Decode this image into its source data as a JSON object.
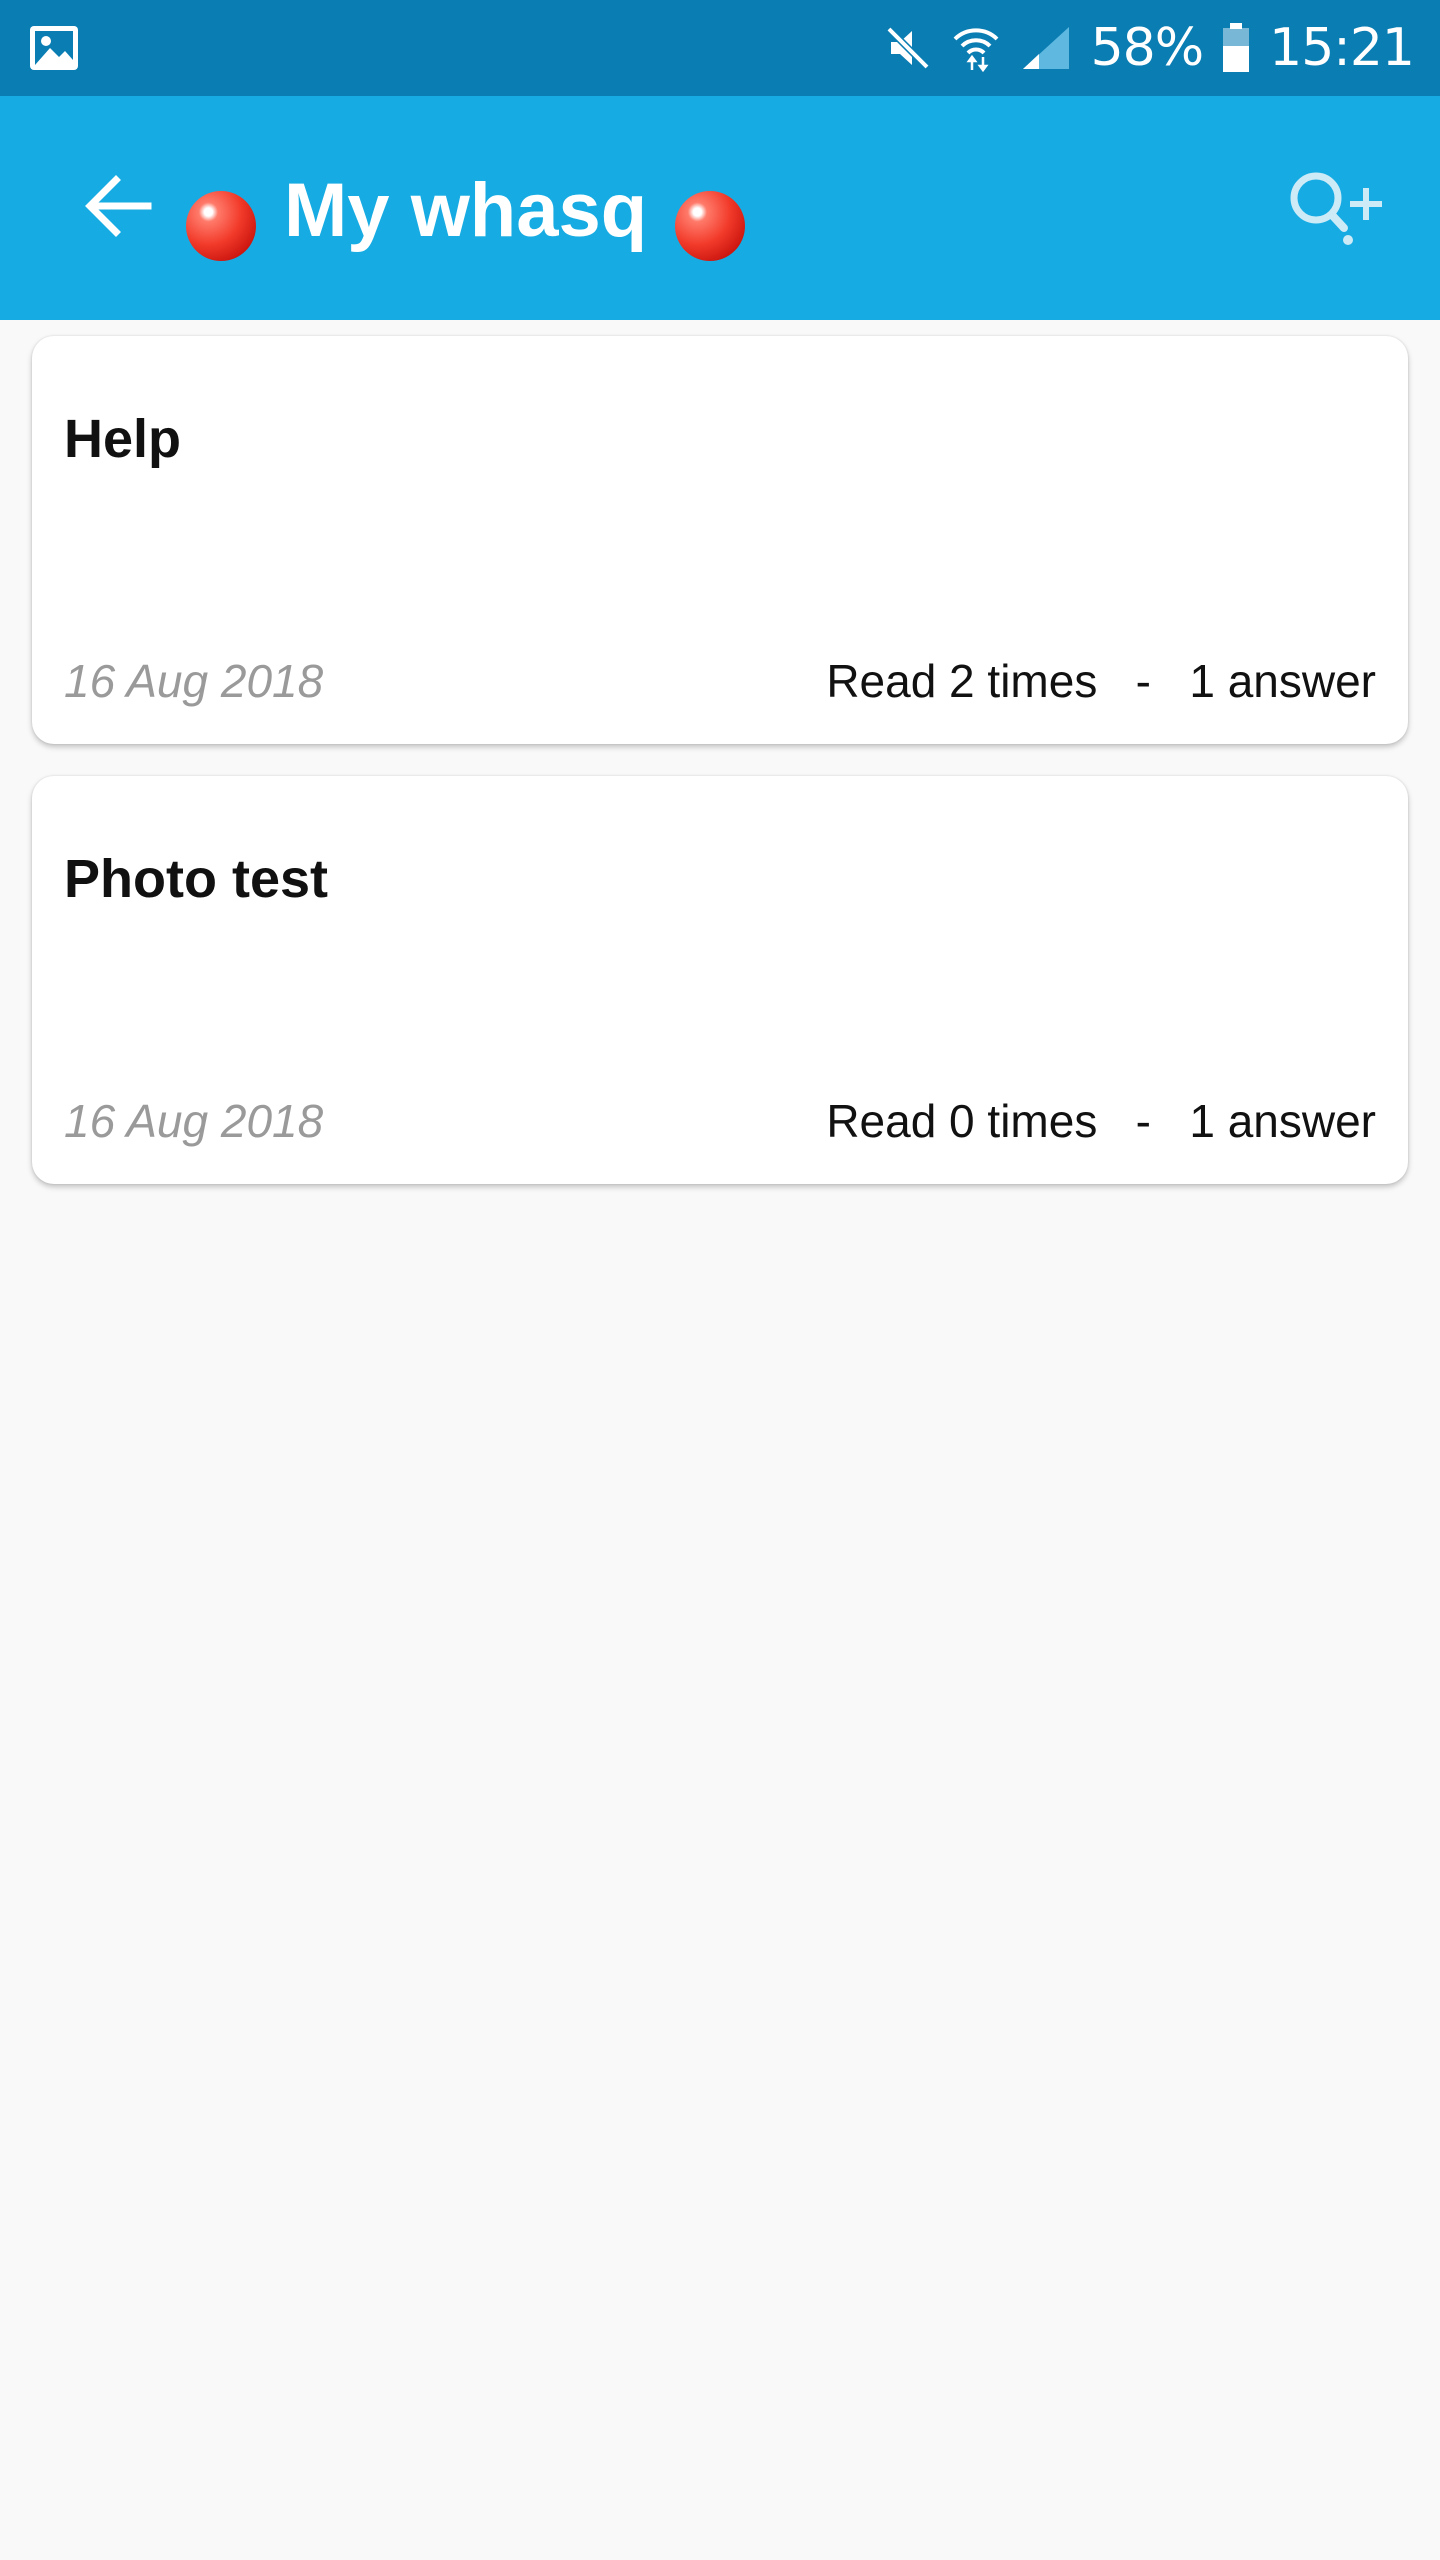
{
  "status_bar": {
    "battery": "58%",
    "time": "15:21",
    "icons": [
      "gallery-icon",
      "mute-icon",
      "wifi-icon",
      "signal-icon",
      "battery-icon"
    ]
  },
  "app_bar": {
    "title": "My whasq",
    "back_icon": "arrow-left-icon",
    "action_icon": "search-plus-icon",
    "background": "#16ace3"
  },
  "cards": [
    {
      "title": "Help",
      "date": "16 Aug 2018",
      "reads": "Read 2 times",
      "separator": "-",
      "answers": "1 answer"
    },
    {
      "title": "Photo test",
      "date": "16 Aug 2018",
      "reads": "Read 0 times",
      "separator": "-",
      "answers": "1 answer"
    }
  ],
  "colors": {
    "status_bar": "#0a7db3",
    "app_bar": "#16ace3",
    "page_background": "#f9f9f9"
  }
}
